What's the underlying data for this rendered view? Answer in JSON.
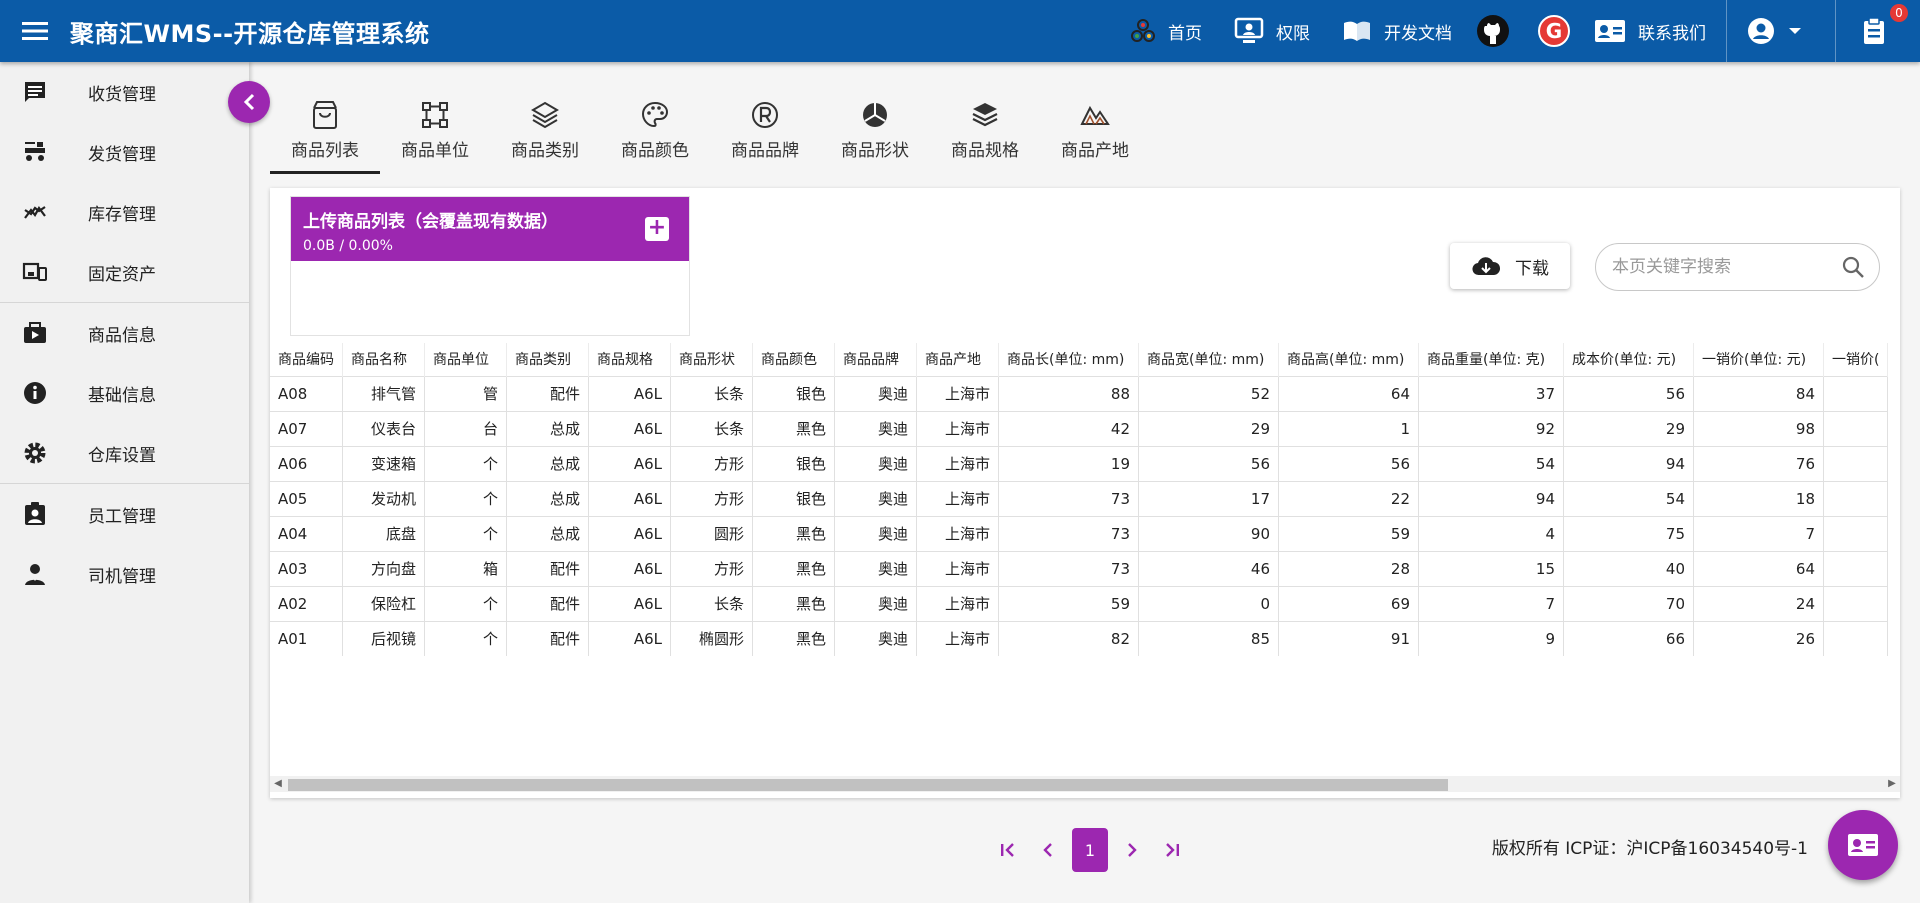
{
  "header": {
    "title": "聚商汇WMS--开源仓库管理系统",
    "nav": [
      {
        "label": "首页",
        "icon": "home-icon"
      },
      {
        "label": "权限",
        "icon": "permission-icon"
      },
      {
        "label": "开发文档",
        "icon": "book-icon"
      }
    ],
    "contact_label": "联系我们",
    "gitee_letter": "G",
    "notifications_count": "0"
  },
  "sidebar": {
    "items": [
      {
        "label": "收货管理",
        "icon": "receive-icon"
      },
      {
        "label": "发货管理",
        "icon": "ship-icon"
      },
      {
        "label": "库存管理",
        "icon": "inventory-icon"
      },
      {
        "label": "固定资产",
        "icon": "asset-icon"
      },
      {
        "label": "商品信息",
        "icon": "product-icon"
      },
      {
        "label": "基础信息",
        "icon": "info-icon"
      },
      {
        "label": "仓库设置",
        "icon": "settings-icon"
      },
      {
        "label": "员工管理",
        "icon": "staff-icon"
      },
      {
        "label": "司机管理",
        "icon": "driver-icon"
      }
    ]
  },
  "tabs": [
    {
      "label": "商品列表",
      "icon": "bag-icon",
      "active": true
    },
    {
      "label": "商品单位",
      "icon": "unit-icon"
    },
    {
      "label": "商品类别",
      "icon": "layers-icon"
    },
    {
      "label": "商品颜色",
      "icon": "palette-icon"
    },
    {
      "label": "商品品牌",
      "icon": "registered-icon"
    },
    {
      "label": "商品形状",
      "icon": "pie-icon"
    },
    {
      "label": "商品规格",
      "icon": "stack-icon"
    },
    {
      "label": "商品产地",
      "icon": "terrain-icon"
    }
  ],
  "uploader": {
    "title": "上传商品列表（会覆盖现有数据）",
    "progress": "0.0B / 0.00%",
    "add_symbol": "+"
  },
  "download_label": "下载",
  "search": {
    "placeholder": "本页关键字搜索"
  },
  "table": {
    "columns": [
      "商品编码",
      "商品名称",
      "商品单位",
      "商品类别",
      "商品规格",
      "商品形状",
      "商品颜色",
      "商品品牌",
      "商品产地",
      "商品长(单位: mm)",
      "商品宽(单位: mm)",
      "商品高(单位: mm)",
      "商品重量(单位: 克)",
      "成本价(单位: 元)",
      "一销价(单位: 元)",
      "一销价("
    ],
    "rows": [
      [
        "A08",
        "排气管",
        "管",
        "配件",
        "A6L",
        "长条",
        "银色",
        "奥迪",
        "上海市",
        "88",
        "52",
        "64",
        "37",
        "56",
        "84",
        ""
      ],
      [
        "A07",
        "仪表台",
        "台",
        "总成",
        "A6L",
        "长条",
        "黑色",
        "奥迪",
        "上海市",
        "42",
        "29",
        "1",
        "92",
        "29",
        "98",
        ""
      ],
      [
        "A06",
        "变速箱",
        "个",
        "总成",
        "A6L",
        "方形",
        "银色",
        "奥迪",
        "上海市",
        "19",
        "56",
        "56",
        "54",
        "94",
        "76",
        ""
      ],
      [
        "A05",
        "发动机",
        "个",
        "总成",
        "A6L",
        "方形",
        "银色",
        "奥迪",
        "上海市",
        "73",
        "17",
        "22",
        "94",
        "54",
        "18",
        ""
      ],
      [
        "A04",
        "底盘",
        "个",
        "总成",
        "A6L",
        "圆形",
        "黑色",
        "奥迪",
        "上海市",
        "73",
        "90",
        "59",
        "4",
        "75",
        "7",
        ""
      ],
      [
        "A03",
        "方向盘",
        "箱",
        "配件",
        "A6L",
        "方形",
        "黑色",
        "奥迪",
        "上海市",
        "73",
        "46",
        "28",
        "15",
        "40",
        "64",
        ""
      ],
      [
        "A02",
        "保险杠",
        "个",
        "配件",
        "A6L",
        "长条",
        "黑色",
        "奥迪",
        "上海市",
        "59",
        "0",
        "69",
        "7",
        "70",
        "24",
        ""
      ],
      [
        "A01",
        "后视镜",
        "个",
        "配件",
        "A6L",
        "椭圆形",
        "黑色",
        "奥迪",
        "上海市",
        "82",
        "85",
        "91",
        "9",
        "66",
        "26",
        ""
      ]
    ]
  },
  "pagination": {
    "current": "1"
  },
  "footer": {
    "copyright": "版权所有 ICP证：沪ICP备16034540号-1"
  },
  "colors": {
    "primary": "#0b5ba7",
    "accent": "#9c27b0"
  }
}
